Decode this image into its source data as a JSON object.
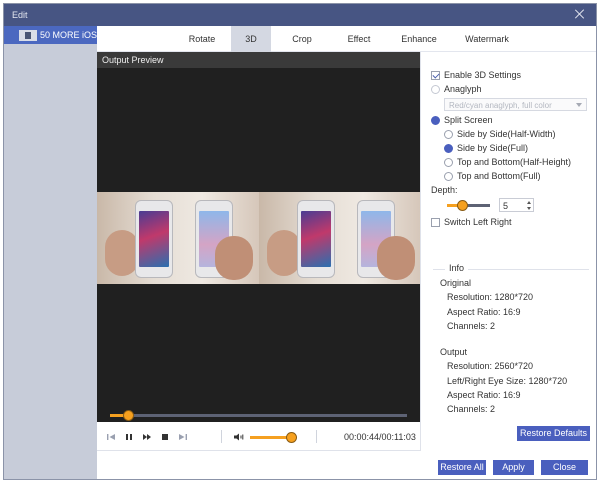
{
  "window": {
    "title": "Edit"
  },
  "sidebar": {
    "items": [
      {
        "label": "50 MORE iOS ..."
      }
    ]
  },
  "tabs": [
    "Rotate",
    "3D",
    "Crop",
    "Effect",
    "Enhance",
    "Watermark"
  ],
  "active_tab": "3D",
  "preview": {
    "header": "Output Preview",
    "seek_progress": 0.06
  },
  "controls": {
    "time": "00:00:44/00:11:03",
    "volume": 0.9
  },
  "settings": {
    "enable_3d": {
      "label": "Enable 3D Settings",
      "checked": true
    },
    "anaglyph": {
      "label": "Anaglyph",
      "selected": false,
      "dropdown_value": "Red/cyan anaglyph, full color"
    },
    "split_screen": {
      "label": "Split Screen",
      "selected": true
    },
    "split_options": [
      {
        "label": "Side by Side(Half-Width)",
        "selected": false
      },
      {
        "label": "Side by Side(Full)",
        "selected": true
      },
      {
        "label": "Top and Bottom(Half-Height)",
        "selected": false
      },
      {
        "label": "Top and Bottom(Full)",
        "selected": false
      }
    ],
    "depth": {
      "label": "Depth:",
      "value": "5",
      "level": 0.35
    },
    "switch_lr": {
      "label": "Switch Left Right",
      "checked": false
    }
  },
  "info": {
    "legend": "Info",
    "original": {
      "heading": "Original",
      "resolution": "Resolution: 1280*720",
      "aspect": "Aspect Ratio: 16:9",
      "channels": "Channels: 2"
    },
    "output": {
      "heading": "Output",
      "resolution": "Resolution: 2560*720",
      "eye_size": "Left/Right Eye Size: 1280*720",
      "aspect": "Aspect Ratio: 16:9",
      "channels": "Channels: 2"
    }
  },
  "buttons": {
    "restore_defaults": "Restore Defaults",
    "restore_all": "Restore All",
    "apply": "Apply",
    "close": "Close"
  },
  "colors": {
    "titlebar": "#475583",
    "accent": "#4a5fbe",
    "slider": "#f5a020",
    "sidebar": "#c7ccd9"
  }
}
